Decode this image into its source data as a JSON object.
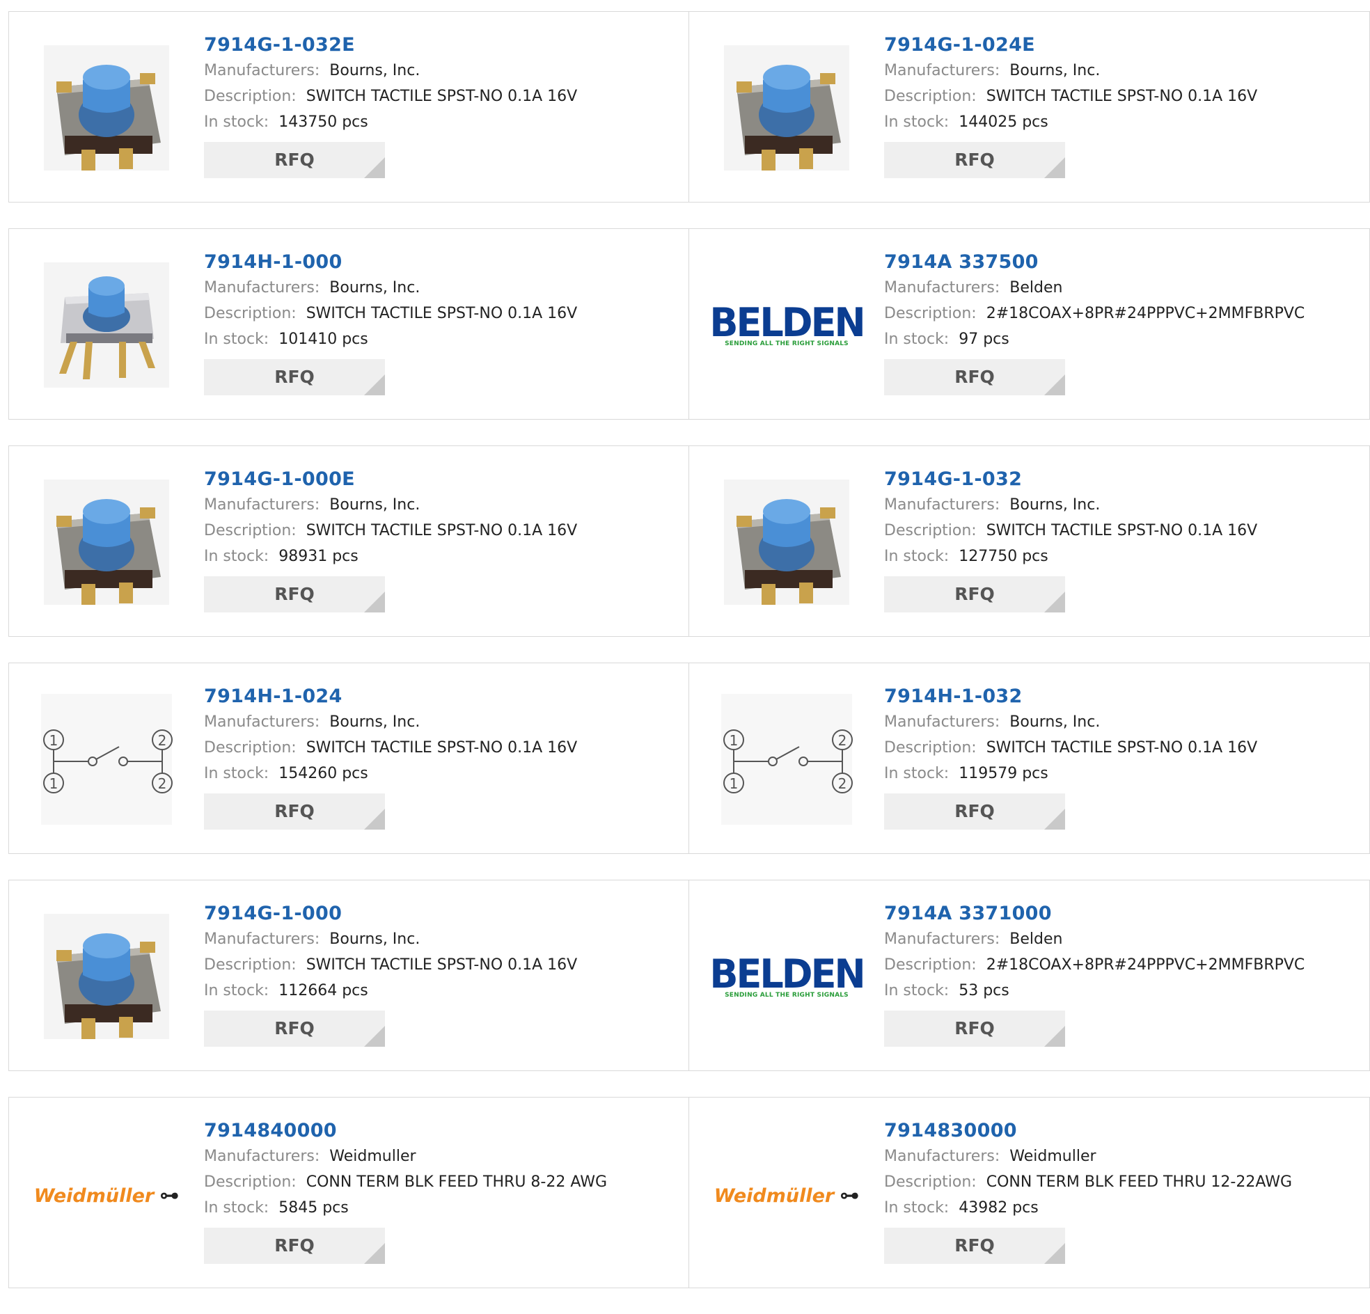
{
  "labels": {
    "manufacturers": "Manufacturers:",
    "description": "Description:",
    "in_stock": "In stock:",
    "rfq": "RFQ"
  },
  "products": [
    {
      "part": "7914G-1-032E",
      "manufacturer": "Bourns, Inc.",
      "description": "SWITCH TACTILE SPST-NO 0.1A 16V",
      "stock": "143750 pcs",
      "image": "tactile-switch-image"
    },
    {
      "part": "7914G-1-024E",
      "manufacturer": "Bourns, Inc.",
      "description": "SWITCH TACTILE SPST-NO 0.1A 16V",
      "stock": "144025 pcs",
      "image": "tactile-switch-image"
    },
    {
      "part": "7914H-1-000",
      "manufacturer": "Bourns, Inc.",
      "description": "SWITCH TACTILE SPST-NO 0.1A 16V",
      "stock": "101410 pcs",
      "image": "tactile-switch-throughhole-image"
    },
    {
      "part": "7914A 337500",
      "manufacturer": "Belden",
      "description": "2#18COAX+8PR#24PPPVC+2MMFBRPVC",
      "stock": "97 pcs",
      "image": "belden-logo",
      "logo_text": "BELDEN",
      "logo_tagline": "SENDING ALL THE RIGHT SIGNALS"
    },
    {
      "part": "7914G-1-000E",
      "manufacturer": "Bourns, Inc.",
      "description": "SWITCH TACTILE SPST-NO 0.1A 16V",
      "stock": "98931 pcs",
      "image": "tactile-switch-image"
    },
    {
      "part": "7914G-1-032",
      "manufacturer": "Bourns, Inc.",
      "description": "SWITCH TACTILE SPST-NO 0.1A 16V",
      "stock": "127750 pcs",
      "image": "tactile-switch-image"
    },
    {
      "part": "7914H-1-024",
      "manufacturer": "Bourns, Inc.",
      "description": "SWITCH TACTILE SPST-NO 0.1A 16V",
      "stock": "154260 pcs",
      "image": "switch-schematic-image"
    },
    {
      "part": "7914H-1-032",
      "manufacturer": "Bourns, Inc.",
      "description": "SWITCH TACTILE SPST-NO 0.1A 16V",
      "stock": "119579 pcs",
      "image": "switch-schematic-image"
    },
    {
      "part": "7914G-1-000",
      "manufacturer": "Bourns, Inc.",
      "description": "SWITCH TACTILE SPST-NO 0.1A 16V",
      "stock": "112664 pcs",
      "image": "tactile-switch-image"
    },
    {
      "part": "7914A 3371000",
      "manufacturer": "Belden",
      "description": "2#18COAX+8PR#24PPPVC+2MMFBRPVC",
      "stock": "53 pcs",
      "image": "belden-logo",
      "logo_text": "BELDEN",
      "logo_tagline": "SENDING ALL THE RIGHT SIGNALS"
    },
    {
      "part": "7914840000",
      "manufacturer": "Weidmuller",
      "description": "CONN TERM BLK FEED THRU 8-22 AWG",
      "stock": "5845 pcs",
      "image": "weidmuller-logo",
      "logo_text": "Weidmüller"
    },
    {
      "part": "7914830000",
      "manufacturer": "Weidmuller",
      "description": "CONN TERM BLK FEED THRU 12-22AWG",
      "stock": "43982 pcs",
      "image": "weidmuller-logo",
      "logo_text": "Weidmüller"
    }
  ],
  "colors": {
    "part_link": "#1f63ad",
    "label": "#8a8a8a",
    "rfq_bg": "#efefef",
    "belden_blue": "#0b3d91",
    "belden_green": "#2a9d3a",
    "weidmuller_orange": "#f08a1e"
  }
}
